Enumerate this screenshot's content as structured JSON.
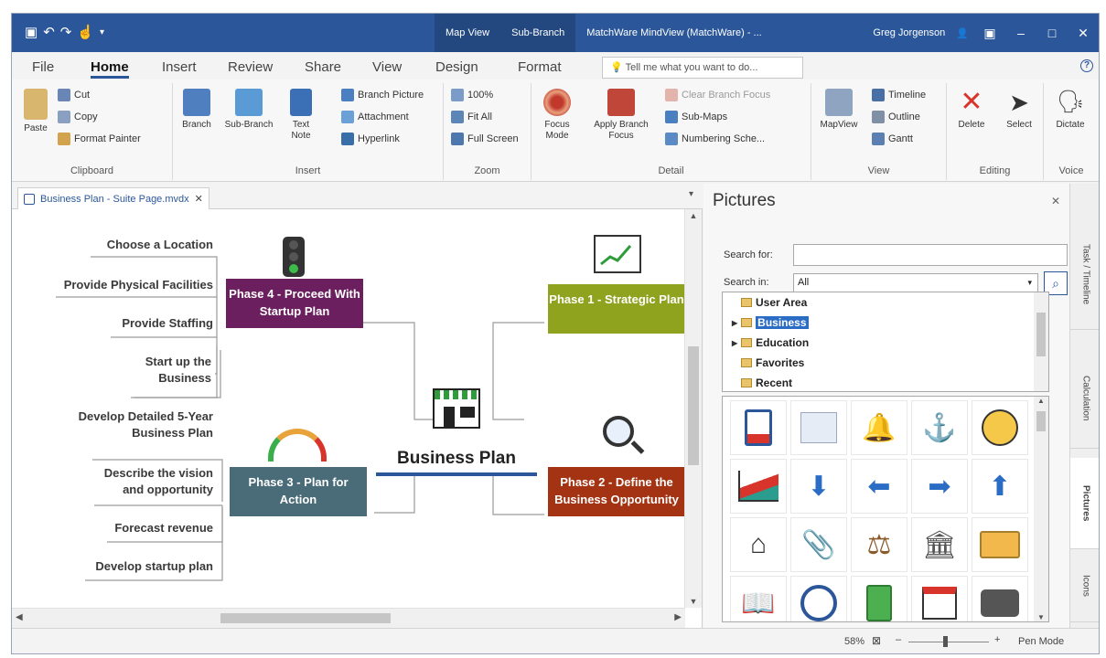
{
  "window": {
    "title": "MatchWare MindView (MatchWare) - ...",
    "context_tabs": [
      "Map View",
      "Sub-Branch"
    ],
    "user": "Greg Jorgenson"
  },
  "tabs": [
    "File",
    "Home",
    "Insert",
    "Review",
    "Share",
    "View",
    "Design",
    "Format"
  ],
  "active_tab": "Home",
  "tellme_placeholder": "Tell me what you want to do...",
  "ribbon": {
    "clipboard": {
      "label": "Clipboard",
      "paste": "Paste",
      "cut": "Cut",
      "copy": "Copy",
      "format_painter": "Format Painter"
    },
    "insert": {
      "label": "Insert",
      "branch": "Branch",
      "sub_branch": "Sub-Branch",
      "text_note": "Text Note",
      "branch_picture": "Branch Picture",
      "attachment": "Attachment",
      "hyperlink": "Hyperlink"
    },
    "zoom": {
      "label": "Zoom",
      "z100": "100%",
      "fit_all": "Fit All",
      "full_screen": "Full Screen"
    },
    "detail": {
      "label": "Detail",
      "focus_mode": "Focus Mode",
      "apply_branch_focus": "Apply Branch Focus",
      "clear_branch_focus": "Clear Branch Focus",
      "sub_maps": "Sub-Maps",
      "numbering": "Numbering Sche..."
    },
    "view": {
      "label": "View",
      "mapview": "MapView",
      "timeline": "Timeline",
      "outline": "Outline",
      "gantt": "Gantt"
    },
    "editing": {
      "label": "Editing",
      "delete": "Delete",
      "select": "Select"
    },
    "voice": {
      "label": "Voice",
      "dictate": "Dictate"
    }
  },
  "document": {
    "tab_title": "Business Plan - Suite Page.mvdx"
  },
  "mindmap": {
    "central": "Business Plan",
    "phase4": "Phase 4 - Proceed With Startup Plan",
    "phase1": "Phase 1 - Strategic Plan",
    "phase3": "Phase 3 - Plan for Action",
    "phase2": "Phase 2 - Define the Business Opportunity",
    "phase4_children": [
      "Choose a Location",
      "Provide Physical Facilities",
      "Provide Staffing",
      "Start up the Business"
    ],
    "phase3_children": [
      "Develop Detailed 5-Year Business Plan",
      "Describe the vision and opportunity",
      "Forecast revenue",
      "Develop startup plan"
    ]
  },
  "pictures": {
    "title": "Pictures",
    "search_for_label": "Search for:",
    "search_for_value": "",
    "search_in_label": "Search in:",
    "search_in_value": "All",
    "tree": [
      "User Area",
      "Business",
      "Education",
      "Favorites",
      "Recent"
    ],
    "selected": "Business"
  },
  "side_tabs": [
    "Task / Timeline",
    "Calculation",
    "Pictures",
    "Icons"
  ],
  "status": {
    "zoom": "58%",
    "pen_mode": "Pen Mode"
  },
  "colors": {
    "accent": "#2b579a",
    "phase4": "#6b1f5e",
    "phase1": "#8fa31e",
    "phase3": "#4a6b78",
    "phase2": "#a33312"
  }
}
